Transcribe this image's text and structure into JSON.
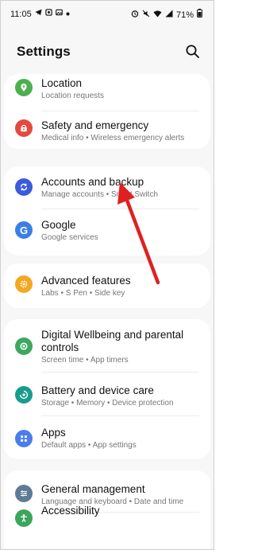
{
  "status_bar": {
    "time": "11:05",
    "battery": "71%"
  },
  "header": {
    "title": "Settings"
  },
  "items": [
    {
      "title": "Location",
      "subtitle": "Location requests",
      "icon": "location-pin-icon",
      "color": "#4caf50"
    },
    {
      "title": "Safety and emergency",
      "subtitle": "Medical info  •  Wireless emergency alerts",
      "icon": "emergency-alert-icon",
      "color": "#e5493d"
    },
    {
      "title": "Accounts and backup",
      "subtitle": "Manage accounts  •  Smart Switch",
      "icon": "sync-icon",
      "color": "#3b5bdb"
    },
    {
      "title": "Google",
      "subtitle": "Google services",
      "icon": "google-icon",
      "color": "#3a7ee8"
    },
    {
      "title": "Advanced features",
      "subtitle": "Labs  •  S Pen  •  Side key",
      "icon": "gear-star-icon",
      "color": "#f3a822"
    },
    {
      "title": "Digital Wellbeing and parental controls",
      "subtitle": "Screen time  •  App timers",
      "icon": "wellbeing-icon",
      "color": "#3ea860"
    },
    {
      "title": "Battery and device care",
      "subtitle": "Storage  •  Memory  •  Device protection",
      "icon": "device-care-icon",
      "color": "#199c8c"
    },
    {
      "title": "Apps",
      "subtitle": "Default apps  •  App settings",
      "icon": "apps-grid-icon",
      "color": "#4a7ee8"
    },
    {
      "title": "General management",
      "subtitle": "Language and keyboard  •  Date and time",
      "icon": "sliders-icon",
      "color": "#5e7a96"
    },
    {
      "title": "Accessibility",
      "subtitle": "",
      "icon": "accessibility-icon",
      "color": "#3ba55c"
    }
  ],
  "annotation": {
    "arrow_color": "#e02020"
  }
}
